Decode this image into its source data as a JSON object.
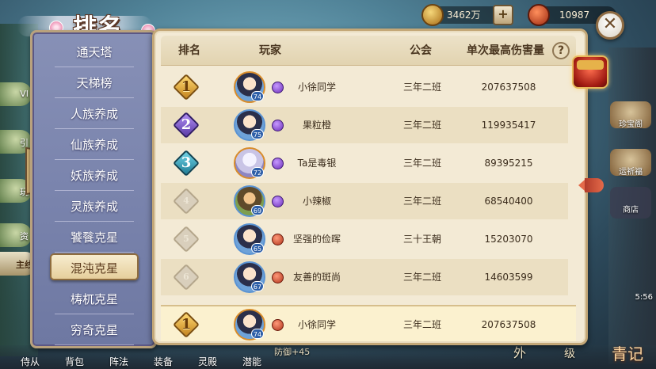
{
  "title": "排名",
  "currency": [
    {
      "name": "gold-coins",
      "value": "3462万"
    },
    {
      "name": "gems",
      "value": "10987"
    }
  ],
  "side_labels": {
    "left": [
      "VI",
      "引",
      "玩",
      "资",
      "主线"
    ],
    "right": [
      "珍宝阁",
      "运祈福",
      "商店",
      "5:56"
    ]
  },
  "menu": {
    "items": [
      "通天塔",
      "天梯榜",
      "人族养成",
      "仙族养成",
      "妖族养成",
      "灵族养成",
      "饕餮克星",
      "混沌克星",
      "梼杌克星",
      "穷奇克星"
    ],
    "active_index": 7
  },
  "table": {
    "headers": {
      "rank": "排名",
      "player": "玩家",
      "guild": "公会",
      "damage": "单次最高伤害量",
      "help": "?"
    },
    "rows": [
      {
        "rank": "1",
        "level": "74",
        "name": "小徐同学",
        "guild": "三年二班",
        "damage": "207637508"
      },
      {
        "rank": "2",
        "level": "75",
        "name": "果粒橙",
        "guild": "三年二班",
        "damage": "119935417"
      },
      {
        "rank": "3",
        "level": "72",
        "name": "Ta是毒银",
        "guild": "三年二班",
        "damage": "89395215"
      },
      {
        "rank": "4",
        "level": "69",
        "name": "小辣椒",
        "guild": "三年二班",
        "damage": "68540400"
      },
      {
        "rank": "5",
        "level": "65",
        "name": "坚强的俭晖",
        "guild": "三十王朝",
        "damage": "15203070"
      },
      {
        "rank": "6",
        "level": "67",
        "name": "友善的斑尚",
        "guild": "三年二班",
        "damage": "14603599"
      }
    ],
    "my_row": {
      "rank": "1",
      "level": "74",
      "name": "小徐同学",
      "guild": "三年二班",
      "damage": "207637508"
    }
  },
  "bottom_bar": {
    "tabs": [
      "侍从",
      "背包",
      "阵法",
      "装备",
      "灵殿",
      "潜能"
    ],
    "stat_text": "防御+45",
    "right_text": [
      "外",
      "级",
      "青记"
    ]
  },
  "colors": {
    "menu_bg": "#7a84ad",
    "panel_bg": "#f3ead5",
    "rank_gold": "#e0a73a",
    "rank_purple": "#7a56c8",
    "rank_teal": "#3aa1b8"
  }
}
